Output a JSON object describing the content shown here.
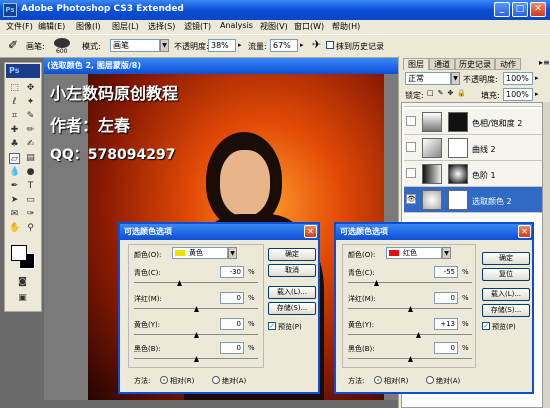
{
  "app": {
    "title": "Adobe Photoshop CS3 Extended",
    "logo": "Ps"
  },
  "menu": [
    "文件(F)",
    "编辑(E)",
    "图像(I)",
    "图层(L)",
    "选择(S)",
    "滤镜(T)",
    "Analysis",
    "视图(V)",
    "窗口(W)",
    "帮助(H)"
  ],
  "options": {
    "brush_label": "画笔:",
    "brush_size": "600",
    "mode_label": "模式:",
    "mode_value": "画笔",
    "opacity_label": "不透明度:",
    "opacity_value": "38%",
    "flow_label": "流量:",
    "flow_value": "67%",
    "history_label": "抹到历史记录"
  },
  "document": {
    "title": "(选取颜色 2, 图层蒙版/8)",
    "overlay_line1": "小左数码原创教程",
    "overlay_line2": "作者：左春",
    "overlay_line3": "QQ：578094297"
  },
  "panel": {
    "tabs": [
      "图层",
      "通道",
      "历史记录",
      "动作"
    ],
    "blend_mode": "正常",
    "opacity_label": "不透明度:",
    "opacity_value": "100%",
    "lock_label": "锁定:",
    "fill_label": "填充:",
    "fill_value": "100%",
    "layers": [
      {
        "name": "色相/饱和度 2"
      },
      {
        "name": "曲线 2"
      },
      {
        "name": "色阶 1"
      },
      {
        "name": "选取颜色 2",
        "selected": true
      }
    ]
  },
  "dialog_yellow": {
    "title": "可选颜色选项",
    "colors_label": "颜色(O):",
    "color_value": "黄色",
    "color_swatch": "#f0e000",
    "sliders": [
      {
        "label": "青色(C):",
        "value": "-30"
      },
      {
        "label": "洋红(M):",
        "value": "0"
      },
      {
        "label": "黄色(Y):",
        "value": "0"
      },
      {
        "label": "黑色(B):",
        "value": "0"
      }
    ],
    "buttons": [
      "确定",
      "取消",
      "载入(L)...",
      "存储(S)..."
    ],
    "preview_label": "预览(P)",
    "method_label": "方法:",
    "method_relative": "相对(R)",
    "method_absolute": "绝对(A)"
  },
  "dialog_red": {
    "title": "可选颜色选项",
    "colors_label": "颜色(O):",
    "color_value": "红色",
    "color_swatch": "#e01010",
    "sliders": [
      {
        "label": "青色(C):",
        "value": "-55"
      },
      {
        "label": "洋红(M):",
        "value": "0"
      },
      {
        "label": "黄色(Y):",
        "value": "+13"
      },
      {
        "label": "黑色(B):",
        "value": "0"
      }
    ],
    "buttons": [
      "确定",
      "复位",
      "载入(L)...",
      "存储(S)..."
    ],
    "preview_label": "预览(P)",
    "method_label": "方法:",
    "method_relative": "相对(R)",
    "method_absolute": "绝对(A)"
  },
  "colors": {
    "title_blue": "#0a4fd6",
    "chrome": "#ece9d8",
    "selection": "#316ac5"
  }
}
